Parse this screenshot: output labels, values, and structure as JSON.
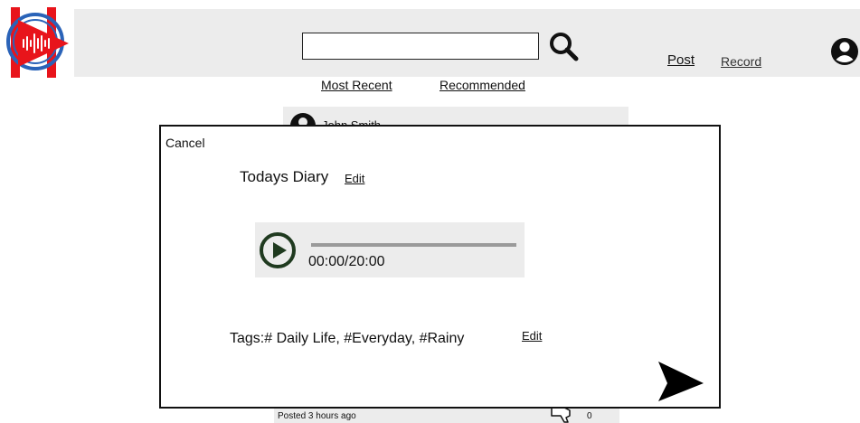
{
  "header": {
    "search": {
      "value": "",
      "placeholder": ""
    },
    "nav": {
      "post": "Post",
      "record": "Record"
    }
  },
  "feed": {
    "tabs": {
      "recent": "Most Recent",
      "recommended": "Recommended"
    },
    "card": {
      "author": "John Smith",
      "posted": "Posted 3 hours ago",
      "dislikes": "0"
    }
  },
  "modal": {
    "cancel": "Cancel",
    "title": "Todays Diary",
    "edit_title": "Edit",
    "player": {
      "time": "00:00/20:00",
      "progress": 0
    },
    "tags": "Tags:# Daily Life, #Everyday, #Rainy",
    "edit_tags": "Edit"
  },
  "colors": {
    "logo_red": "#e8141b",
    "logo_blue": "#2a63b8",
    "header_bg": "#ececec",
    "player_bg": "#ececec",
    "play_green": "#1f3a1f"
  },
  "icons": {
    "logo": "play-waveform-logo",
    "search": "search-icon",
    "account": "user-icon",
    "play": "play-icon",
    "send": "send-icon",
    "dislike": "thumbs-down-icon"
  }
}
